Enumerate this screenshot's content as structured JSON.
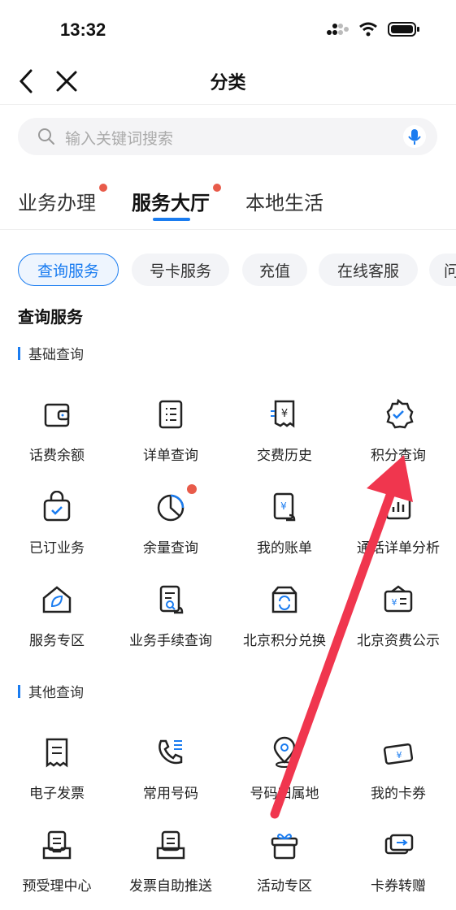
{
  "status": {
    "time": "13:32"
  },
  "nav": {
    "title": "分类"
  },
  "search": {
    "placeholder": "输入关键词搜索"
  },
  "tabs": [
    {
      "label": "业务办理",
      "has_dot": true
    },
    {
      "label": "服务大厅",
      "has_dot": true,
      "active": true
    },
    {
      "label": "本地生活",
      "has_dot": false
    }
  ],
  "chips": [
    {
      "label": "查询服务",
      "active": true
    },
    {
      "label": "号卡服务"
    },
    {
      "label": "充值"
    },
    {
      "label": "在线客服"
    },
    {
      "label": "问"
    }
  ],
  "section": {
    "title": "查询服务"
  },
  "groups": [
    {
      "title": "基础查询",
      "items": [
        {
          "label": "话费余额",
          "icon": "wallet-icon"
        },
        {
          "label": "详单查询",
          "icon": "list-document-icon"
        },
        {
          "label": "交费历史",
          "icon": "payment-receipt-icon"
        },
        {
          "label": "积分查询",
          "icon": "badge-check-icon"
        },
        {
          "label": "已订业务",
          "icon": "shopping-bag-check-icon"
        },
        {
          "label": "余量查询",
          "icon": "pie-chart-icon",
          "has_dot": true
        },
        {
          "label": "我的账单",
          "icon": "bill-icon"
        },
        {
          "label": "通话详单分析",
          "icon": "bar-chart-icon"
        },
        {
          "label": "服务专区",
          "icon": "home-leaf-icon"
        },
        {
          "label": "业务手续查询",
          "icon": "document-search-icon"
        },
        {
          "label": "北京积分兑换",
          "icon": "box-exchange-icon"
        },
        {
          "label": "北京资费公示",
          "icon": "price-card-icon"
        }
      ]
    },
    {
      "title": "其他查询",
      "items": [
        {
          "label": "电子发票",
          "icon": "invoice-icon"
        },
        {
          "label": "常用号码",
          "icon": "phone-list-icon"
        },
        {
          "label": "号码归属地",
          "icon": "location-pin-icon"
        },
        {
          "label": "我的卡券",
          "icon": "coupon-icon"
        },
        {
          "label": "预受理中心",
          "icon": "document-tray-icon"
        },
        {
          "label": "发票自助推送",
          "icon": "invoice-send-icon"
        },
        {
          "label": "活动专区",
          "icon": "gift-icon"
        },
        {
          "label": "卡券转赠",
          "icon": "card-transfer-icon"
        }
      ]
    }
  ],
  "colors": {
    "accent": "#1a7cf0",
    "dot": "#e85b4a",
    "annotation_arrow": "#f0364e"
  }
}
